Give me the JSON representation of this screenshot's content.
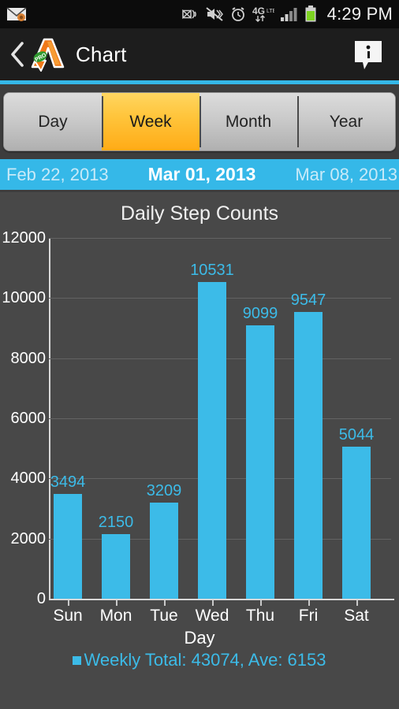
{
  "statusbar": {
    "clock": "4:29 PM",
    "network_label": "4G",
    "icons": [
      "email-icon",
      "gps-location-icon",
      "vibrate-mute-icon",
      "alarm-clock-icon",
      "network-4g-icon",
      "signal-bars-icon",
      "battery-icon"
    ]
  },
  "actionbar": {
    "title": "Chart",
    "back_label": "‹",
    "logo_badge": "PRO",
    "info_label": "i"
  },
  "tabs": {
    "items": [
      {
        "label": "Day",
        "active": false
      },
      {
        "label": "Week",
        "active": true
      },
      {
        "label": "Month",
        "active": false
      },
      {
        "label": "Year",
        "active": false
      }
    ]
  },
  "datestrip": {
    "previous": "Feb 22, 2013",
    "current": "Mar 01, 2013",
    "next": "Mar 08, 2013"
  },
  "chart_data": {
    "type": "bar",
    "title": "Daily Step Counts",
    "xlabel": "Day",
    "ylabel": "",
    "categories": [
      "Sun",
      "Mon",
      "Tue",
      "Wed",
      "Thu",
      "Fri",
      "Sat"
    ],
    "values": [
      3494,
      2150,
      3209,
      10531,
      9099,
      9547,
      5044
    ],
    "ylim": [
      0,
      12000
    ],
    "yticks": [
      0,
      2000,
      4000,
      6000,
      8000,
      10000,
      12000
    ],
    "ytick_labels": [
      "0",
      "2000",
      "4000",
      "6000",
      "8000",
      "10000",
      "12000"
    ],
    "data_labels": [
      "3494",
      "2150",
      "3209",
      "10531",
      "9099",
      "9547",
      "5044"
    ],
    "grid": true,
    "legend_position": "bottom",
    "legend": [
      "Weekly Total: 43074, Ave: 6153"
    ],
    "bar_color": "#3cbbe8",
    "background": "#484848"
  },
  "legend": {
    "text": "Weekly Total: 43074, Ave: 6153"
  },
  "colors": {
    "accent": "#35b8e8",
    "bar": "#3cbbe8",
    "tab_active_top": "#ffd661",
    "tab_active_bottom": "#ffab16",
    "chart_bg": "#484848",
    "actionbar_bg": "#1d1d1d"
  }
}
